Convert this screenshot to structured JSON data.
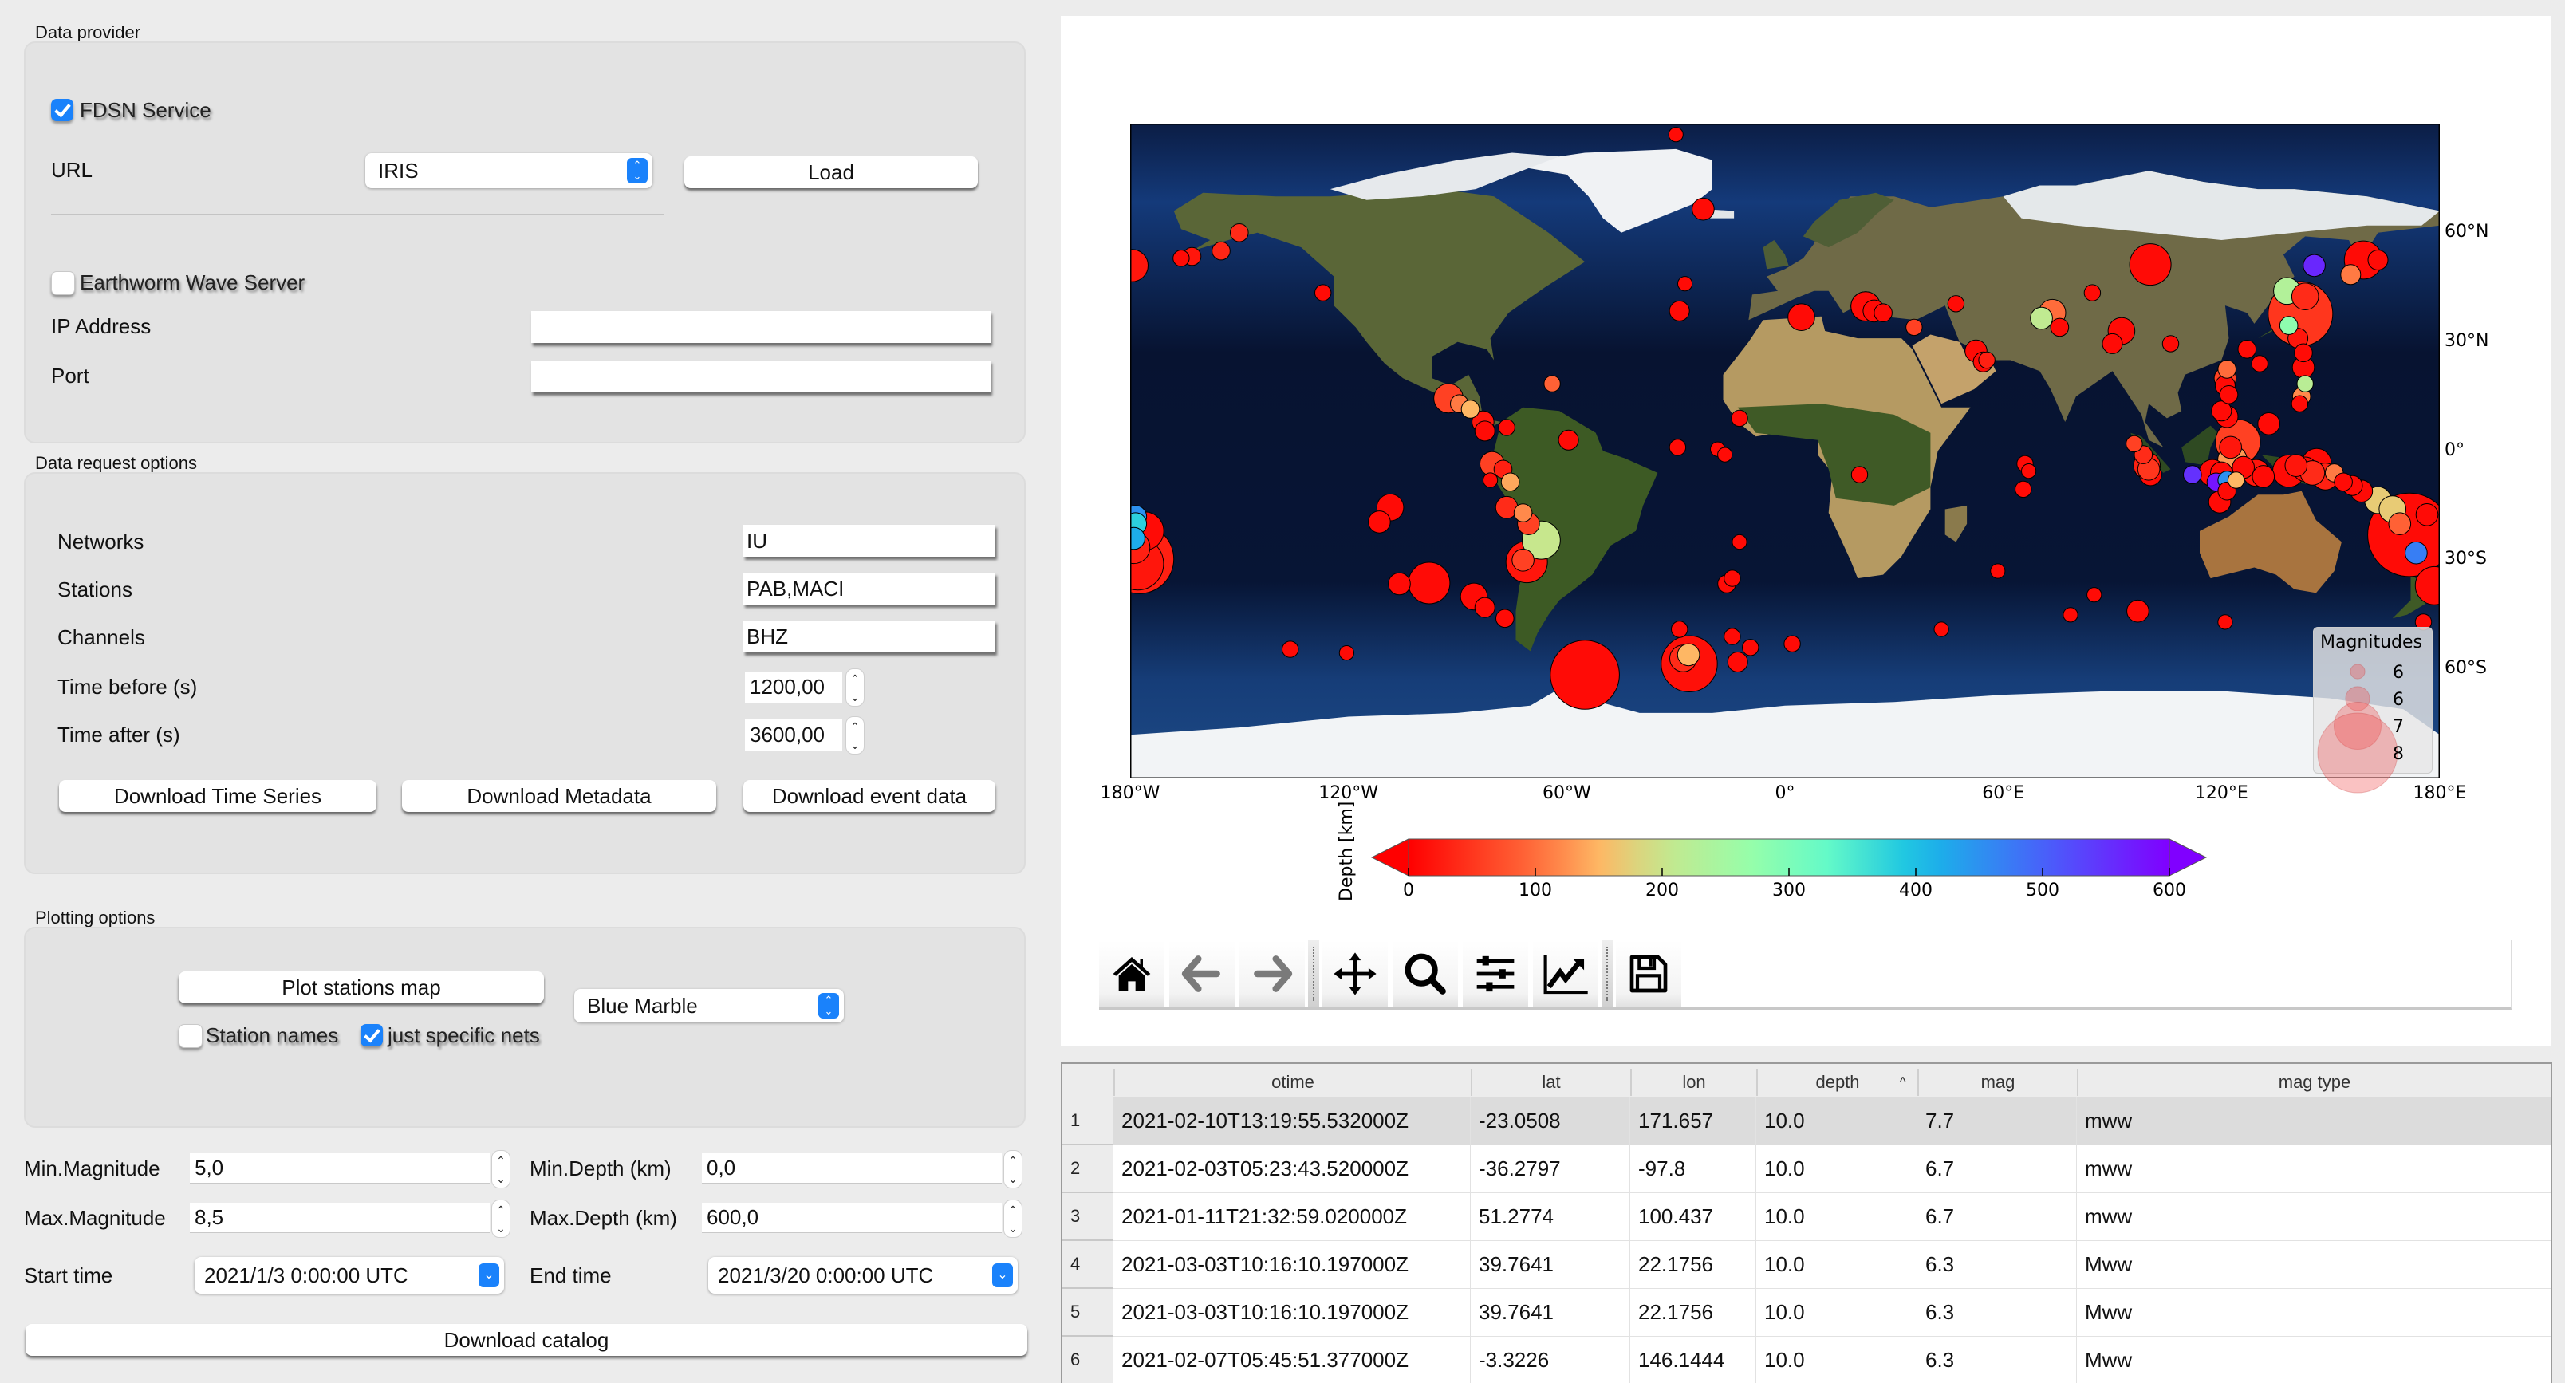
{
  "data_provider": {
    "title": "Data provider",
    "fdsn_label": "FDSN Service",
    "fdsn_checked": true,
    "url_label": "URL",
    "url_value": "IRIS",
    "load_button": "Load",
    "earthworm_label": "Earthworm Wave Server",
    "earthworm_checked": false,
    "ip_label": "IP Address",
    "ip_value": "",
    "port_label": "Port",
    "port_value": ""
  },
  "data_request": {
    "title": "Data request options",
    "networks_label": "Networks",
    "networks_value": "IU",
    "stations_label": "Stations",
    "stations_value": "PAB,MACI",
    "channels_label": "Channels",
    "channels_value": "BHZ",
    "time_before_label": "Time before (s)",
    "time_before_value": "1200,00",
    "time_after_label": "Time after (s)",
    "time_after_value": "3600,00",
    "btn_time_series": "Download Time Series",
    "btn_metadata": "Download Metadata",
    "btn_event_data": "Download event data"
  },
  "plotting": {
    "title": "Plotting options",
    "plot_stations_button": "Plot stations map",
    "basemap_value": "Blue Marble",
    "station_names_label": "Station names",
    "station_names_checked": false,
    "specific_nets_label": "just specific nets",
    "specific_nets_checked": true
  },
  "catalog": {
    "min_mag_label": "Min.Magnitude",
    "min_mag_value": "5,0",
    "max_mag_label": "Max.Magnitude",
    "max_mag_value": "8,5",
    "min_depth_label": "Min.Depth (km)",
    "min_depth_value": "0,0",
    "max_depth_label": "Max.Depth (km)",
    "max_depth_value": "600,0",
    "start_label": "Start time",
    "start_value": "2021/1/3 0:00:00 UTC",
    "end_label": "End time",
    "end_value": "2021/3/20 0:00:00 UTC",
    "download_button": "Download catalog"
  },
  "toolbar": {
    "buttons": [
      "home-icon",
      "back-arrow-icon",
      "forward-arrow-icon",
      "pan-icon",
      "zoom-icon",
      "configure-subplots-icon",
      "edit-axis-icon",
      "save-icon"
    ]
  },
  "chart_data": {
    "type": "scatter",
    "title": "",
    "basemap": "Blue Marble",
    "x_ticks": [
      "180°W",
      "120°W",
      "60°W",
      "0°",
      "60°E",
      "120°E",
      "180°E"
    ],
    "x_tick_values": [
      -180,
      -120,
      -60,
      0,
      60,
      120,
      180
    ],
    "y_ticks": [
      "60°N",
      "30°N",
      "0°",
      "30°S",
      "60°S"
    ],
    "y_tick_values": [
      60,
      30,
      0,
      -30,
      -60
    ],
    "xlim": [
      -180,
      180
    ],
    "ylim": [
      -90,
      90
    ],
    "colorbar": {
      "label": "Depth [km]",
      "ticks": [
        "0",
        "100",
        "200",
        "300",
        "400",
        "500",
        "600"
      ],
      "tick_values": [
        0,
        100,
        200,
        300,
        400,
        500,
        600
      ],
      "range": [
        0,
        600
      ],
      "colormap": "rainbow_r",
      "extend": "both"
    },
    "legend": {
      "title": "Magnitudes",
      "placement": "lower-right",
      "labels": [
        "6",
        "6",
        "7",
        "8"
      ],
      "mags": [
        5.7,
        6.2,
        7.0,
        7.8
      ]
    },
    "events": [
      {
        "lon": 171.657,
        "lat": -23.0508,
        "depth": 10,
        "mag": 7.7
      },
      {
        "lon": -97.8,
        "lat": -36.2797,
        "depth": 10,
        "mag": 6.7
      },
      {
        "lon": 100.437,
        "lat": 51.2774,
        "depth": 10,
        "mag": 6.7
      },
      {
        "lon": 22.1756,
        "lat": 39.7641,
        "depth": 10,
        "mag": 6.3
      },
      {
        "lon": 22.1756,
        "lat": 39.7641,
        "depth": 10,
        "mag": 6.3
      },
      {
        "lon": 146.1444,
        "lat": -3.3226,
        "depth": 10,
        "mag": 6.3
      },
      {
        "lon": 141.7,
        "lat": 37.7,
        "depth": 50,
        "mag": 7.3
      },
      {
        "lon": -26.3,
        "lat": -58.5,
        "depth": 15,
        "mag": 7.1
      },
      {
        "lon": -177.5,
        "lat": -29.7,
        "depth": 30,
        "mag": 7.4
      },
      {
        "lon": -178.0,
        "lat": -31.0,
        "depth": 20,
        "mag": 7.0
      },
      {
        "lon": -176.0,
        "lat": -22.0,
        "depth": 10,
        "mag": 6.6
      },
      {
        "lon": -178.5,
        "lat": -18.0,
        "depth": 450,
        "mag": 6.0
      },
      {
        "lon": -178.5,
        "lat": -20.0,
        "depth": 380,
        "mag": 6.0
      },
      {
        "lon": -179.0,
        "lat": -24.0,
        "depth": 420,
        "mag": 6.0
      },
      {
        "lon": -179.0,
        "lat": -26.5,
        "depth": 30,
        "mag": 6.4
      },
      {
        "lon": -179.5,
        "lat": 51.0,
        "depth": 20,
        "mag": 6.4
      },
      {
        "lon": -166.0,
        "lat": 53.0,
        "depth": 10,
        "mag": 5.7
      },
      {
        "lon": -163.0,
        "lat": 53.5,
        "depth": 20,
        "mag": 5.8
      },
      {
        "lon": -155.0,
        "lat": 55.0,
        "depth": 35,
        "mag": 5.8
      },
      {
        "lon": -150.0,
        "lat": 60.0,
        "depth": 40,
        "mag": 5.8
      },
      {
        "lon": -127.0,
        "lat": 43.5,
        "depth": 10,
        "mag": 5.7
      },
      {
        "lon": -92.5,
        "lat": 14.5,
        "depth": 60,
        "mag": 6.3
      },
      {
        "lon": -89.5,
        "lat": 13.0,
        "depth": 110,
        "mag": 5.8
      },
      {
        "lon": -86.5,
        "lat": 11.5,
        "depth": 150,
        "mag": 5.8
      },
      {
        "lon": -83.0,
        "lat": 8.0,
        "depth": 20,
        "mag": 6.0
      },
      {
        "lon": -82.5,
        "lat": 5.5,
        "depth": 10,
        "mag": 5.9
      },
      {
        "lon": -76.5,
        "lat": 6.5,
        "depth": 10,
        "mag": 5.7
      },
      {
        "lon": -59.5,
        "lat": 3.0,
        "depth": 10,
        "mag": 5.9
      },
      {
        "lon": -64.0,
        "lat": 18.5,
        "depth": 90,
        "mag": 5.7
      },
      {
        "lon": -80.5,
        "lat": -3.5,
        "depth": 60,
        "mag": 6.1
      },
      {
        "lon": -77.5,
        "lat": -5.0,
        "depth": 30,
        "mag": 5.8
      },
      {
        "lon": -81.0,
        "lat": -8.0,
        "depth": 10,
        "mag": 5.6
      },
      {
        "lon": -75.5,
        "lat": -8.5,
        "depth": 140,
        "mag": 5.8
      },
      {
        "lon": -76.5,
        "lat": -15.5,
        "depth": 40,
        "mag": 6.0
      },
      {
        "lon": -72.0,
        "lat": -17.0,
        "depth": 120,
        "mag": 5.8
      },
      {
        "lon": -70.5,
        "lat": -20.0,
        "depth": 60,
        "mag": 6.0
      },
      {
        "lon": -67.0,
        "lat": -24.5,
        "depth": 200,
        "mag": 6.6
      },
      {
        "lon": -71.0,
        "lat": -30.5,
        "depth": 20,
        "mag": 6.7
      },
      {
        "lon": -72.0,
        "lat": -30.0,
        "depth": 60,
        "mag": 6.0
      },
      {
        "lon": -108.5,
        "lat": -15.5,
        "depth": 10,
        "mag": 6.2
      },
      {
        "lon": -111.5,
        "lat": -19.5,
        "depth": 10,
        "mag": 6.0
      },
      {
        "lon": -106.0,
        "lat": -36.5,
        "depth": 10,
        "mag": 6.0
      },
      {
        "lon": -85.5,
        "lat": -40.0,
        "depth": 10,
        "mag": 6.2
      },
      {
        "lon": -82.5,
        "lat": -43.0,
        "depth": 10,
        "mag": 5.9
      },
      {
        "lon": -77.0,
        "lat": -46.0,
        "depth": 10,
        "mag": 5.8
      },
      {
        "lon": -136.0,
        "lat": -54.5,
        "depth": 10,
        "mag": 5.7
      },
      {
        "lon": -120.5,
        "lat": -55.5,
        "depth": 10,
        "mag": 5.6
      },
      {
        "lon": -55.0,
        "lat": -61.5,
        "depth": 10,
        "mag": 7.4
      },
      {
        "lon": -29.0,
        "lat": -49.0,
        "depth": 10,
        "mag": 5.7
      },
      {
        "lon": -28.0,
        "lat": -57.0,
        "depth": 40,
        "mag": 6.2
      },
      {
        "lon": -26.5,
        "lat": -56.0,
        "depth": 150,
        "mag": 6.0
      },
      {
        "lon": -14.5,
        "lat": -51.0,
        "depth": 10,
        "mag": 5.7
      },
      {
        "lon": -9.5,
        "lat": -54.0,
        "depth": 10,
        "mag": 5.7
      },
      {
        "lon": 2.0,
        "lat": -53.0,
        "depth": 10,
        "mag": 5.7
      },
      {
        "lon": -13.0,
        "lat": -58.0,
        "depth": 10,
        "mag": 5.9
      },
      {
        "lon": -29.5,
        "lat": 1.0,
        "depth": 10,
        "mag": 5.7
      },
      {
        "lon": -18.5,
        "lat": 0.5,
        "depth": 10,
        "mag": 5.6
      },
      {
        "lon": -16.5,
        "lat": -1.0,
        "depth": 10,
        "mag": 5.6
      },
      {
        "lon": -12.5,
        "lat": -25.0,
        "depth": 10,
        "mag": 5.6
      },
      {
        "lon": -14.5,
        "lat": -35.0,
        "depth": 10,
        "mag": 5.7
      },
      {
        "lon": -16.0,
        "lat": -36.5,
        "depth": 10,
        "mag": 5.8
      },
      {
        "lon": -27.5,
        "lat": 46.0,
        "depth": 10,
        "mag": 5.6
      },
      {
        "lon": -29.0,
        "lat": 38.5,
        "depth": 10,
        "mag": 5.9
      },
      {
        "lon": -22.5,
        "lat": 66.5,
        "depth": 10,
        "mag": 6.0
      },
      {
        "lon": -30.0,
        "lat": 87.0,
        "depth": 10,
        "mag": 5.6
      },
      {
        "lon": -12.5,
        "lat": 9.0,
        "depth": 10,
        "mag": 5.7
      },
      {
        "lon": 4.5,
        "lat": 36.8,
        "depth": 10,
        "mag": 6.2
      },
      {
        "lon": 24.5,
        "lat": 38.5,
        "depth": 10,
        "mag": 6.0
      },
      {
        "lon": 27.0,
        "lat": 38.0,
        "depth": 10,
        "mag": 5.8
      },
      {
        "lon": 35.5,
        "lat": 34.0,
        "depth": 60,
        "mag": 5.7
      },
      {
        "lon": 47.0,
        "lat": 40.5,
        "depth": 10,
        "mag": 5.7
      },
      {
        "lon": 52.5,
        "lat": 27.5,
        "depth": 10,
        "mag": 6.0
      },
      {
        "lon": 54.5,
        "lat": 24.5,
        "depth": 10,
        "mag": 5.9
      },
      {
        "lon": 55.5,
        "lat": 25.0,
        "depth": 30,
        "mag": 5.7
      },
      {
        "lon": 73.5,
        "lat": 38.0,
        "depth": 100,
        "mag": 6.2
      },
      {
        "lon": 70.5,
        "lat": 36.5,
        "depth": 210,
        "mag": 6.0
      },
      {
        "lon": 75.5,
        "lat": 34.0,
        "depth": 10,
        "mag": 5.8
      },
      {
        "lon": 84.5,
        "lat": 43.5,
        "depth": 10,
        "mag": 5.7
      },
      {
        "lon": 92.5,
        "lat": 33.0,
        "depth": 10,
        "mag": 6.2
      },
      {
        "lon": 90.0,
        "lat": 29.5,
        "depth": 10,
        "mag": 5.9
      },
      {
        "lon": 106.0,
        "lat": 29.5,
        "depth": 10,
        "mag": 5.7
      },
      {
        "lon": 20.5,
        "lat": -6.5,
        "depth": 10,
        "mag": 5.7
      },
      {
        "lon": 66.0,
        "lat": -3.5,
        "depth": 10,
        "mag": 5.7
      },
      {
        "lon": 67.0,
        "lat": -5.5,
        "depth": 10,
        "mag": 5.6
      },
      {
        "lon": 65.5,
        "lat": -10.5,
        "depth": 10,
        "mag": 5.7
      },
      {
        "lon": 58.5,
        "lat": -33.0,
        "depth": 10,
        "mag": 5.6
      },
      {
        "lon": 85.0,
        "lat": -39.5,
        "depth": 10,
        "mag": 5.6
      },
      {
        "lon": 97.0,
        "lat": -44.0,
        "depth": 10,
        "mag": 6.0
      },
      {
        "lon": 78.5,
        "lat": -45.0,
        "depth": 10,
        "mag": 5.6
      },
      {
        "lon": 43.0,
        "lat": -49.0,
        "depth": 10,
        "mag": 5.6
      },
      {
        "lon": 121.0,
        "lat": -47.0,
        "depth": 10,
        "mag": 5.6
      },
      {
        "lon": 96.0,
        "lat": 2.0,
        "depth": 60,
        "mag": 5.7
      },
      {
        "lon": 98.5,
        "lat": -1.0,
        "depth": 40,
        "mag": 5.8
      },
      {
        "lon": 99.5,
        "lat": -4.0,
        "depth": 30,
        "mag": 6.2
      },
      {
        "lon": 100.5,
        "lat": -6.5,
        "depth": 10,
        "mag": 6.0
      },
      {
        "lon": 100.0,
        "lat": -5.0,
        "depth": 50,
        "mag": 6.0
      },
      {
        "lon": 112.0,
        "lat": -6.5,
        "depth": 550,
        "mag": 5.8
      },
      {
        "lon": 118.5,
        "lat": -8.5,
        "depth": 580,
        "mag": 5.8
      },
      {
        "lon": 121.5,
        "lat": -8.0,
        "depth": 450,
        "mag": 5.8
      },
      {
        "lon": 117.5,
        "lat": -6.0,
        "depth": 10,
        "mag": 6.2
      },
      {
        "lon": 120.0,
        "lat": -6.0,
        "depth": 10,
        "mag": 6.0
      },
      {
        "lon": 121.5,
        "lat": -11.0,
        "depth": 10,
        "mag": 5.8
      },
      {
        "lon": 119.5,
        "lat": -14.0,
        "depth": 10,
        "mag": 6.0
      },
      {
        "lon": 124.0,
        "lat": -8.0,
        "depth": 150,
        "mag": 5.7
      },
      {
        "lon": 123.0,
        "lat": -2.5,
        "depth": 130,
        "mag": 6.3
      },
      {
        "lon": 124.5,
        "lat": 2.5,
        "depth": 60,
        "mag": 6.8
      },
      {
        "lon": 122.5,
        "lat": 1.0,
        "depth": 20,
        "mag": 6.0
      },
      {
        "lon": 126.0,
        "lat": -4.5,
        "depth": 10,
        "mag": 6.0
      },
      {
        "lon": 129.5,
        "lat": -6.0,
        "depth": 20,
        "mag": 6.2
      },
      {
        "lon": 131.5,
        "lat": -7.0,
        "depth": 10,
        "mag": 6.0
      },
      {
        "lon": 138.5,
        "lat": -5.5,
        "depth": 10,
        "mag": 6.4
      },
      {
        "lon": 140.5,
        "lat": -4.0,
        "depth": 20,
        "mag": 6.0
      },
      {
        "lon": 143.0,
        "lat": -5.0,
        "depth": 10,
        "mag": 6.1
      },
      {
        "lon": 145.0,
        "lat": -6.0,
        "depth": 40,
        "mag": 6.1
      },
      {
        "lon": 148.5,
        "lat": -7.0,
        "depth": 30,
        "mag": 6.2
      },
      {
        "lon": 151.0,
        "lat": -6.0,
        "depth": 110,
        "mag": 5.8
      },
      {
        "lon": 153.5,
        "lat": -8.5,
        "depth": 10,
        "mag": 5.8
      },
      {
        "lon": 156.0,
        "lat": -9.5,
        "depth": 10,
        "mag": 5.9
      },
      {
        "lon": 158.5,
        "lat": -11.0,
        "depth": 10,
        "mag": 6.0
      },
      {
        "lon": 163.0,
        "lat": -13.5,
        "depth": 170,
        "mag": 6.2
      },
      {
        "lon": 167.0,
        "lat": -16.0,
        "depth": 170,
        "mag": 6.2
      },
      {
        "lon": 169.0,
        "lat": -20.0,
        "depth": 90,
        "mag": 6.0
      },
      {
        "lon": 176.5,
        "lat": -17.5,
        "depth": 10,
        "mag": 6.0
      },
      {
        "lon": 178.5,
        "lat": -37.0,
        "depth": 10,
        "mag": 6.6
      },
      {
        "lon": 175.5,
        "lat": -47.0,
        "depth": 10,
        "mag": 5.7
      },
      {
        "lon": 122.0,
        "lat": 15.5,
        "depth": 10,
        "mag": 5.8
      },
      {
        "lon": 121.0,
        "lat": 20.0,
        "depth": 60,
        "mag": 6.0
      },
      {
        "lon": 121.5,
        "lat": 22.5,
        "depth": 100,
        "mag": 5.8
      },
      {
        "lon": 121.0,
        "lat": 18.0,
        "depth": 10,
        "mag": 5.9
      },
      {
        "lon": 120.0,
        "lat": 11.0,
        "depth": 10,
        "mag": 5.9
      },
      {
        "lon": 121.5,
        "lat": 9.5,
        "depth": 10,
        "mag": 6.0
      },
      {
        "lon": 127.0,
        "lat": 28.0,
        "depth": 10,
        "mag": 5.8
      },
      {
        "lon": 130.5,
        "lat": 24.0,
        "depth": 10,
        "mag": 5.7
      },
      {
        "lon": 138.5,
        "lat": 34.5,
        "depth": 280,
        "mag": 5.8
      },
      {
        "lon": 141.0,
        "lat": 31.0,
        "depth": 20,
        "mag": 5.9
      },
      {
        "lon": 142.5,
        "lat": 27.0,
        "depth": 10,
        "mag": 5.8
      },
      {
        "lon": 142.5,
        "lat": 23.0,
        "depth": 10,
        "mag": 6.0
      },
      {
        "lon": 143.0,
        "lat": 18.5,
        "depth": 220,
        "mag": 5.7
      },
      {
        "lon": 142.0,
        "lat": 15.0,
        "depth": 120,
        "mag": 5.8
      },
      {
        "lon": 141.5,
        "lat": 13.0,
        "depth": 10,
        "mag": 5.7
      },
      {
        "lon": 133.0,
        "lat": 7.5,
        "depth": 10,
        "mag": 6.0
      },
      {
        "lon": 138.0,
        "lat": 44.0,
        "depth": 230,
        "mag": 6.2
      },
      {
        "lon": 143.0,
        "lat": 42.5,
        "depth": 40,
        "mag": 6.2
      },
      {
        "lon": 145.5,
        "lat": 51.0,
        "depth": 560,
        "mag": 6.0
      },
      {
        "lon": 155.5,
        "lat": 48.5,
        "depth": 110,
        "mag": 5.9
      },
      {
        "lon": 159.0,
        "lat": 52.5,
        "depth": 10,
        "mag": 6.6
      },
      {
        "lon": 163.0,
        "lat": 52.5,
        "depth": 10,
        "mag": 5.9
      },
      {
        "lon": 173.5,
        "lat": -28.0,
        "depth": 470,
        "mag": 6.0
      }
    ]
  },
  "table": {
    "columns": [
      "otime",
      "lat",
      "lon",
      "depth",
      "mag",
      "mag type"
    ],
    "sort_column": "depth",
    "sort_indicator": "^",
    "rows": [
      {
        "num": "1",
        "otime": "2021-02-10T13:19:55.532000Z",
        "lat": "-23.0508",
        "lon": "171.657",
        "depth": "10.0",
        "mag": "7.7",
        "magtype": "mww"
      },
      {
        "num": "2",
        "otime": "2021-02-03T05:23:43.520000Z",
        "lat": "-36.2797",
        "lon": "-97.8",
        "depth": "10.0",
        "mag": "6.7",
        "magtype": "mww"
      },
      {
        "num": "3",
        "otime": "2021-01-11T21:32:59.020000Z",
        "lat": "51.2774",
        "lon": "100.437",
        "depth": "10.0",
        "mag": "6.7",
        "magtype": "mww"
      },
      {
        "num": "4",
        "otime": "2021-03-03T10:16:10.197000Z",
        "lat": "39.7641",
        "lon": "22.1756",
        "depth": "10.0",
        "mag": "6.3",
        "magtype": "Mww"
      },
      {
        "num": "5",
        "otime": "2021-03-03T10:16:10.197000Z",
        "lat": "39.7641",
        "lon": "22.1756",
        "depth": "10.0",
        "mag": "6.3",
        "magtype": "Mww"
      },
      {
        "num": "6",
        "otime": "2021-02-07T05:45:51.377000Z",
        "lat": "-3.3226",
        "lon": "146.1444",
        "depth": "10.0",
        "mag": "6.3",
        "magtype": "Mww"
      }
    ]
  }
}
